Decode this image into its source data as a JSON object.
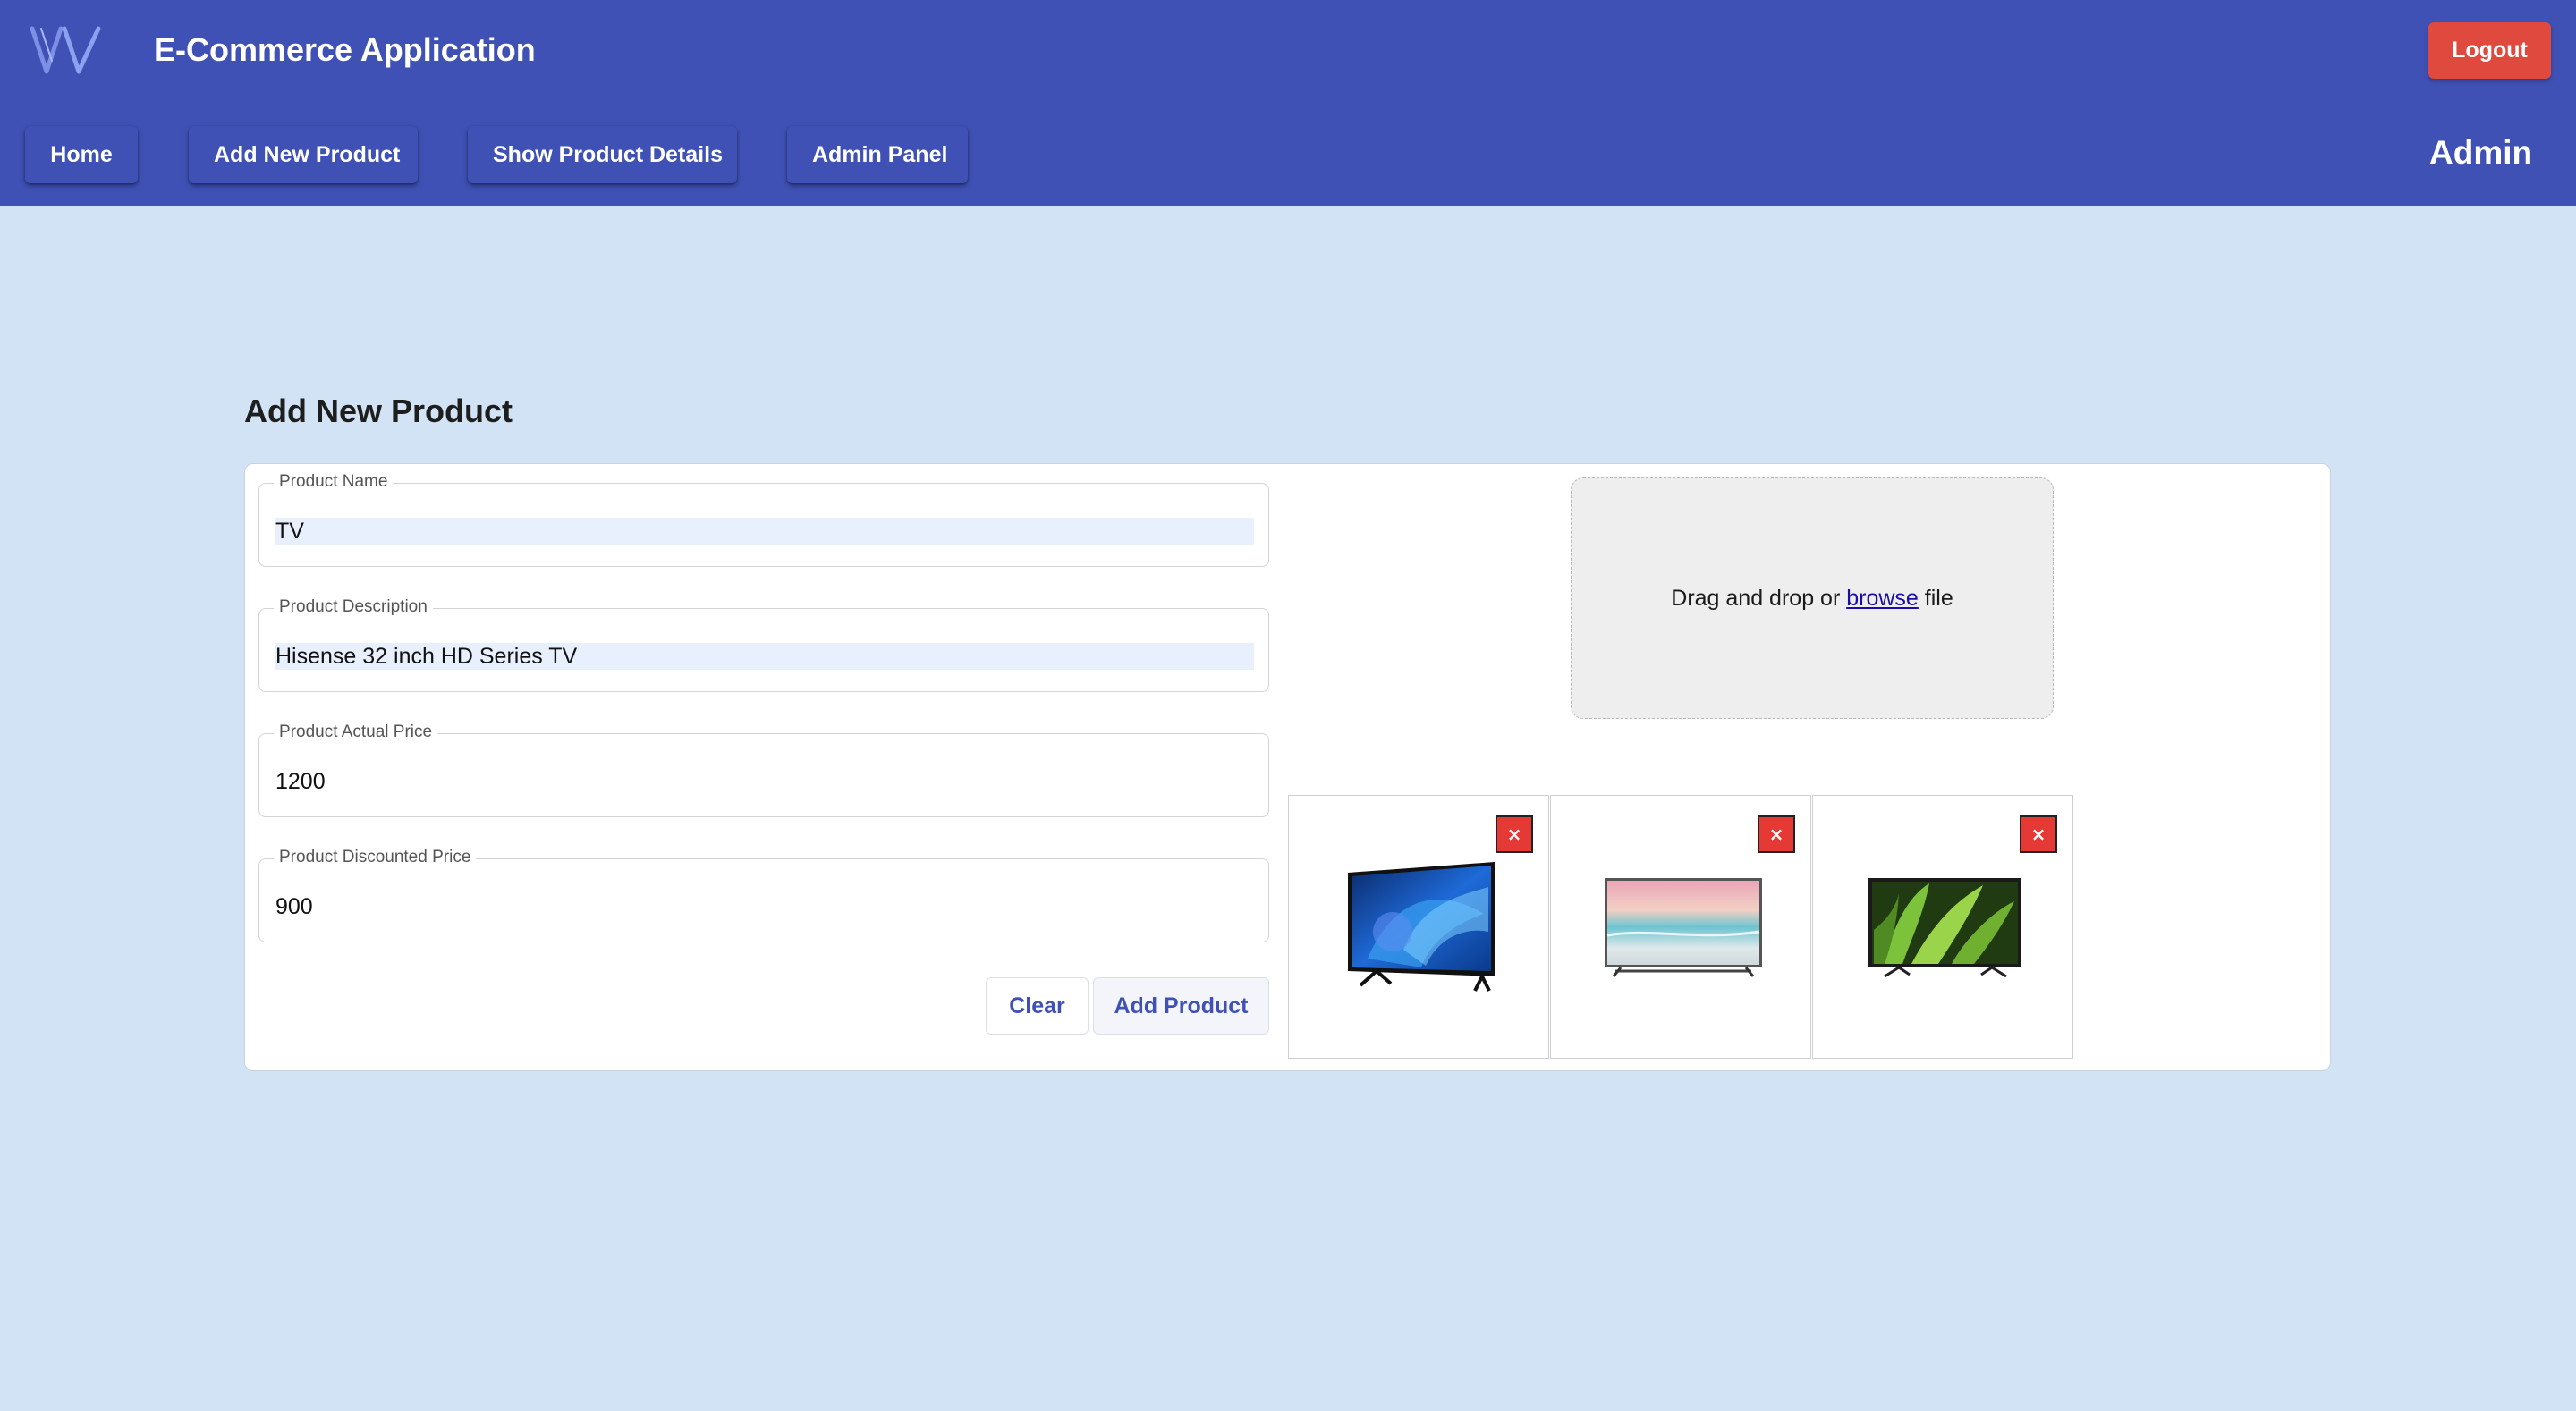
{
  "header": {
    "logo_icon": "vv-logo-icon",
    "title": "E-Commerce Application",
    "logout_label": "Logout",
    "role_label": "Admin",
    "nav": [
      {
        "label": "Home"
      },
      {
        "label": "Add New Product"
      },
      {
        "label": "Show Product Details"
      },
      {
        "label": "Admin Panel"
      }
    ]
  },
  "form": {
    "title": "Add New Product",
    "fields": {
      "name": {
        "label": "Product Name",
        "value": "TV"
      },
      "description": {
        "label": "Product Description",
        "value": "Hisense 32 inch HD Series TV"
      },
      "actual_price": {
        "label": "Product Actual Price",
        "value": "1200"
      },
      "discounted_price": {
        "label": "Product Discounted Price",
        "value": "900"
      }
    },
    "clear_label": "Clear",
    "submit_label": "Add Product"
  },
  "dropzone": {
    "text_before": "Drag and drop or ",
    "link_text": "browse",
    "text_after": " file"
  },
  "images": [
    {
      "icon": "tv-image-blue-waves",
      "remove_label": "×"
    },
    {
      "icon": "tv-image-beach",
      "remove_label": "×"
    },
    {
      "icon": "tv-image-green-leaves",
      "remove_label": "×"
    }
  ],
  "colors": {
    "primary": "#3f51b5",
    "logout": "#e0493d",
    "background": "#d1e3f5",
    "remove": "#e53935"
  }
}
